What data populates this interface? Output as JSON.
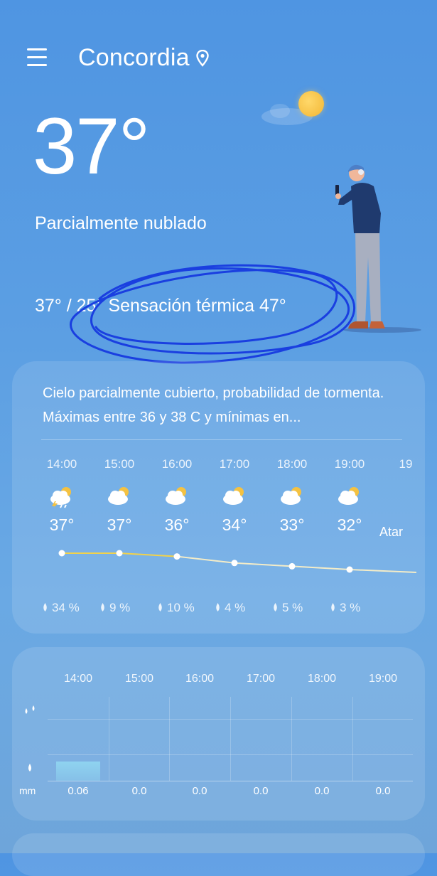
{
  "header": {
    "city": "Concordia",
    "menu_icon": "menu-icon",
    "location_icon": "location-pin-icon"
  },
  "current": {
    "temperature": "37°",
    "condition": "Parcialmente nublado",
    "range_feels": "37° / 25° Sensación térmica 47°"
  },
  "forecast_card": {
    "summary": "Cielo parcialmente cubierto, probabilidad de tormenta. Máximas entre 36 y 38 C y mínimas en...",
    "hours": [
      {
        "time": "14:00",
        "temp": "37°",
        "temp_value": 37,
        "prob": "34 %",
        "icon": "thunderstorm-partly-cloudy-icon"
      },
      {
        "time": "15:00",
        "temp": "37°",
        "temp_value": 37,
        "prob": "9 %",
        "icon": "partly-cloudy-icon"
      },
      {
        "time": "16:00",
        "temp": "36°",
        "temp_value": 36,
        "prob": "10 %",
        "icon": "partly-cloudy-icon"
      },
      {
        "time": "17:00",
        "temp": "34°",
        "temp_value": 34,
        "prob": "4 %",
        "icon": "partly-cloudy-icon"
      },
      {
        "time": "18:00",
        "temp": "33°",
        "temp_value": 33,
        "prob": "5 %",
        "icon": "partly-cloudy-icon"
      },
      {
        "time": "19:00",
        "temp": "32°",
        "temp_value": 32,
        "prob": "3 %",
        "icon": "partly-cloudy-icon"
      }
    ],
    "next_partial": {
      "time": "19",
      "label": "Atar"
    }
  },
  "precip_card": {
    "unit": "mm",
    "times": [
      "14:00",
      "15:00",
      "16:00",
      "17:00",
      "18:00",
      "19:00"
    ],
    "values": [
      "0.06",
      "0.0",
      "0.0",
      "0.0",
      "0.0",
      "0.0"
    ],
    "colors": {
      "bar": "#8fd3f0"
    }
  }
}
